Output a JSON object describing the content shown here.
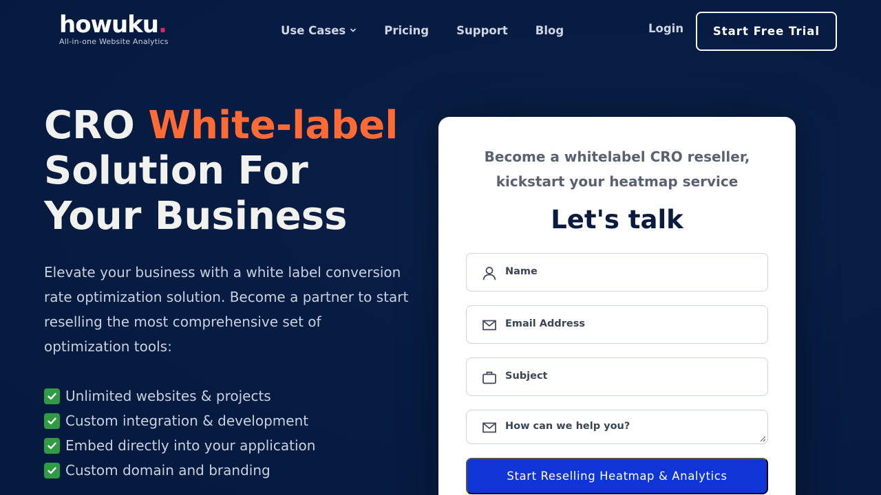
{
  "header": {
    "logo_text": "howuku",
    "logo_dot": ".",
    "tagline": "All-in-one Website Analytics",
    "nav": [
      {
        "label": "Use Cases",
        "has_dropdown": true
      },
      {
        "label": "Pricing"
      },
      {
        "label": "Support"
      },
      {
        "label": "Blog"
      }
    ],
    "login_label": "Login",
    "trial_label": "Start Free Trial"
  },
  "hero": {
    "title_prefix": "CRO ",
    "title_accent": "White-label",
    "title_rest": "Solution For Your Business",
    "description": "Elevate your business with a white label conversion rate optimization solution. Become a partner to start reselling the most comprehensive set of optimization tools:",
    "features": [
      "Unlimited websites & projects",
      "Custom integration & development",
      "Embed directly into your application",
      "Custom domain and branding"
    ]
  },
  "form": {
    "subtitle_line1": "Become a whitelabel CRO reseller,",
    "subtitle_line2": "kickstart your heatmap service",
    "title": "Let's talk",
    "fields": {
      "name": {
        "label": "Name",
        "icon": "user-icon"
      },
      "email": {
        "label": "Email Address",
        "icon": "mail-icon"
      },
      "subject": {
        "label": "Subject",
        "icon": "briefcase-icon"
      },
      "message": {
        "label": "How can we help you?",
        "icon": "mail-icon"
      }
    },
    "submit_label": "Start Reselling Heatmap & Analytics"
  },
  "colors": {
    "background": "#061a3f",
    "accent_orange": "#ff6a35",
    "button_blue": "#0f35d6",
    "logo_dot": "#e0245e",
    "check_green": "#2f9b45"
  }
}
